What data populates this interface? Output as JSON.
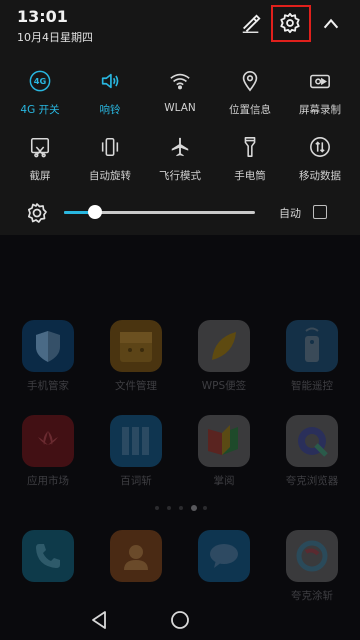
{
  "status": {
    "time": "13:01",
    "date": "10月4日星期四"
  },
  "header": {
    "edit_icon": "pencil-icon",
    "settings_icon": "gear-icon",
    "collapse_icon": "chevron-up-icon",
    "highlight_color": "#e0201c"
  },
  "quick_settings": {
    "accent_color": "#29b7e0",
    "tiles": [
      {
        "label": "4G 开关",
        "icon": "4g-icon",
        "active": true
      },
      {
        "label": "响铃",
        "icon": "speaker-icon",
        "active": true
      },
      {
        "label": "WLAN",
        "icon": "wifi-icon",
        "active": false
      },
      {
        "label": "位置信息",
        "icon": "location-pin-icon",
        "active": false
      },
      {
        "label": "屏幕录制",
        "icon": "screen-record-icon",
        "active": false
      },
      {
        "label": "截屏",
        "icon": "screenshot-icon",
        "active": false
      },
      {
        "label": "自动旋转",
        "icon": "rotate-icon",
        "active": false
      },
      {
        "label": "飞行模式",
        "icon": "airplane-icon",
        "active": false
      },
      {
        "label": "手电筒",
        "icon": "flashlight-icon",
        "active": false
      },
      {
        "label": "移动数据",
        "icon": "mobile-data-icon",
        "active": false
      }
    ]
  },
  "brightness": {
    "level": 0.16,
    "auto_label": "自动",
    "auto_checked": false
  },
  "home": {
    "apps": [
      {
        "name": "手机管家"
      },
      {
        "name": "文件管理"
      },
      {
        "name": "WPS便签"
      },
      {
        "name": "智能遥控"
      },
      {
        "name": "应用市场"
      },
      {
        "name": "百词斩"
      },
      {
        "name": "掌阅"
      },
      {
        "name": "夸克浏览器"
      },
      {
        "name": ""
      },
      {
        "name": ""
      },
      {
        "name": ""
      },
      {
        "name": "夸克涂斩"
      }
    ],
    "page_count": 5,
    "current_page": 4
  },
  "navbar": {
    "back_icon": "back-triangle-icon",
    "home_icon": "home-circle-icon"
  }
}
